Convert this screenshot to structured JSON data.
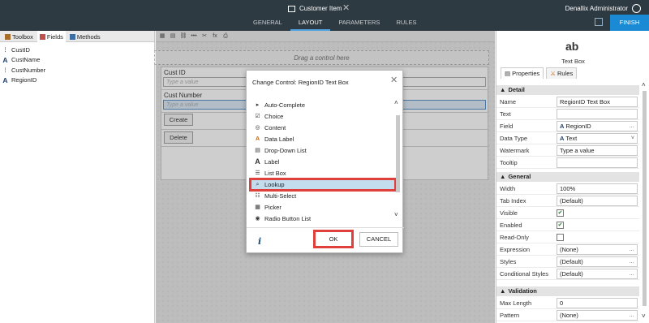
{
  "window": {
    "document_title": "Customer Item",
    "close_glyph": "✕",
    "tabs": [
      {
        "label": "GENERAL"
      },
      {
        "label": "LAYOUT"
      },
      {
        "label": "PARAMETERS"
      },
      {
        "label": "RULES"
      }
    ],
    "user_name": "Denallix Administrator",
    "finish_label": "FINISH"
  },
  "left_panel": {
    "tabs": [
      {
        "label": "Toolbox"
      },
      {
        "label": "Fields"
      },
      {
        "label": "Methods"
      }
    ],
    "fields": [
      {
        "label": "CustID",
        "icon": "number-field-icon",
        "glyph": "⋮"
      },
      {
        "label": "CustName",
        "icon": "text-field-icon",
        "glyph": "A"
      },
      {
        "label": "CustNumber",
        "icon": "number-field-icon",
        "glyph": "⋮"
      },
      {
        "label": "RegionID",
        "icon": "text-field-icon",
        "glyph": "A"
      }
    ]
  },
  "canvas": {
    "dropzone_text": "Drag a control here",
    "cust_id_label": "Cust ID",
    "cust_id_placeholder": "Type a value",
    "cust_number_label": "Cust Number",
    "cust_number_placeholder": "Type a value",
    "create_label": "Create",
    "delete_label": "Delete",
    "toolbar_glyphs": [
      "▦",
      "▤",
      "⛓",
      "•••",
      "✂",
      "fx",
      "⎙"
    ]
  },
  "dialog": {
    "title": "Change Control: RegionID Text Box",
    "close_glyph": "✕",
    "controls": [
      {
        "label": "Auto-Complete",
        "icon": "autocomplete-icon",
        "glyph": "▸"
      },
      {
        "label": "Choice",
        "icon": "choice-icon",
        "glyph": "☑"
      },
      {
        "label": "Content",
        "icon": "content-icon",
        "glyph": "◎"
      },
      {
        "label": "Data Label",
        "icon": "data-label-icon",
        "glyph": "A"
      },
      {
        "label": "Drop-Down List",
        "icon": "dropdown-list-icon",
        "glyph": "▤"
      },
      {
        "label": "Label",
        "icon": "label-icon",
        "glyph": "A"
      },
      {
        "label": "List Box",
        "icon": "list-box-icon",
        "glyph": "☰"
      },
      {
        "label": "Lookup",
        "icon": "lookup-icon",
        "glyph": "⌕",
        "selected": true
      },
      {
        "label": "Multi-Select",
        "icon": "multi-select-icon",
        "glyph": "☷"
      },
      {
        "label": "Picker",
        "icon": "picker-icon",
        "glyph": "▦"
      },
      {
        "label": "Radio Button List",
        "icon": "radio-list-icon",
        "glyph": "◉"
      }
    ],
    "info_glyph": "i",
    "ok_label": "OK",
    "cancel_label": "CANCEL"
  },
  "right_panel": {
    "control_icon_text": "ab",
    "control_type": "Text Box",
    "tabs": [
      {
        "label": "Properties"
      },
      {
        "label": "Rules"
      }
    ],
    "sections": {
      "detail": "Detail",
      "general": "General",
      "validation": "Validation"
    },
    "properties": {
      "name": {
        "label": "Name",
        "value": "RegionID Text Box"
      },
      "text": {
        "label": "Text",
        "value": ""
      },
      "field": {
        "label": "Field",
        "value": "RegionID"
      },
      "data_type": {
        "label": "Data Type",
        "value": "Text"
      },
      "watermark": {
        "label": "Watermark",
        "value": "Type a value"
      },
      "tooltip": {
        "label": "Tooltip",
        "value": ""
      },
      "width": {
        "label": "Width",
        "value": "100%"
      },
      "tab_index": {
        "label": "Tab Index",
        "value": "(Default)"
      },
      "visible": {
        "label": "Visible",
        "checked": true
      },
      "enabled": {
        "label": "Enabled",
        "checked": true
      },
      "read_only": {
        "label": "Read-Only",
        "checked": false
      },
      "expression": {
        "label": "Expression",
        "value": "(None)"
      },
      "styles": {
        "label": "Styles",
        "value": "(Default)"
      },
      "conditional_styles": {
        "label": "Conditional Styles",
        "value": "(Default)"
      },
      "max_length": {
        "label": "Max Length",
        "value": "0"
      },
      "pattern": {
        "label": "Pattern",
        "value": "(None)"
      }
    }
  },
  "colors": {
    "header_bg": "#2e3a42",
    "finish_bg": "#1a8ad4",
    "highlight_red": "#e0403b",
    "selection_blue": "#c3dcee"
  }
}
